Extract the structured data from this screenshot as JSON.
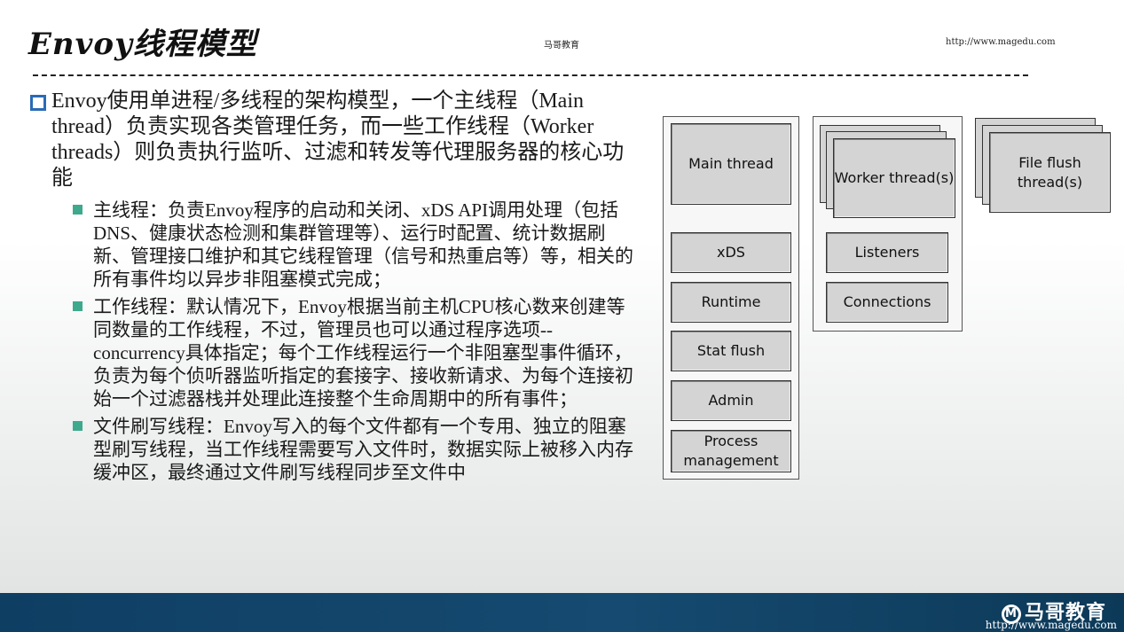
{
  "header": {
    "title": "Envoy线程模型",
    "center_text": "马哥教育",
    "url": "http://www.magedu.com"
  },
  "content": {
    "main_point": "Envoy使用单进程/多线程的架构模型，一个主线程（Main thread）负责实现各类管理任务，而一些工作线程（Worker threads）则负责执行监听、过滤和转发等代理服务器的核心功能",
    "sub_points": [
      "主线程：负责Envoy程序的启动和关闭、xDS API调用处理（包括DNS、健康状态检测和集群管理等）、运行时配置、统计数据刷新、管理接口维护和其它线程管理（信号和热重启等）等，相关的所有事件均以异步非阻塞模式完成；",
      "工作线程：默认情况下，Envoy根据当前主机CPU核心数来创建等同数量的工作线程，不过，管理员也可以通过程序选项--concurrency具体指定；每个工作线程运行一个非阻塞型事件循环，负责为每个侦听器监听指定的套接字、接收新请求、为每个连接初始一个过滤器栈并处理此连接整个生命周期中的所有事件；",
      "文件刷写线程：Envoy写入的每个文件都有一个专用、独立的阻塞型刷写线程，当工作线程需要写入文件时，数据实际上被移入内存缓冲区，最终通过文件刷写线程同步至文件中"
    ]
  },
  "diagram": {
    "main_thread": {
      "title": "Main thread",
      "components": [
        "xDS",
        "Runtime",
        "Stat flush",
        "Admin",
        "Process management"
      ]
    },
    "worker_threads": {
      "title": "Worker thread(s)",
      "components": [
        "Listeners",
        "Connections"
      ]
    },
    "file_flush": {
      "title": "File flush thread(s)"
    }
  },
  "footer": {
    "logo_text": "马哥教育",
    "url": "http://www.magedu.com"
  },
  "colors": {
    "bullet_main": "#2a6bb6",
    "bullet_sub": "#3ea98d",
    "footer_bg": "#164a70",
    "box_fill": "#d4d4d4"
  }
}
